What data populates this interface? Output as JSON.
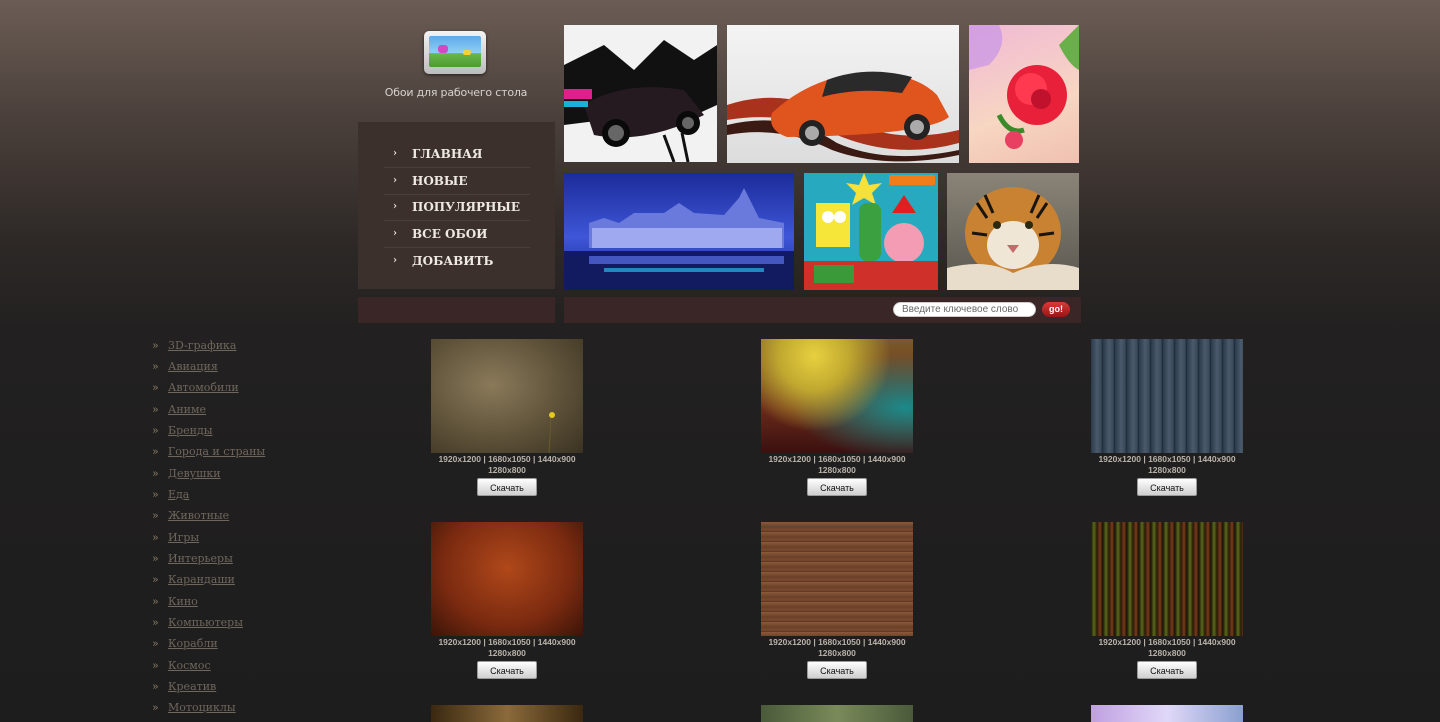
{
  "site": {
    "logo_icon": "desktop-wallpaper-icon",
    "caption": "Обои для рабочего стола"
  },
  "menu": {
    "items": [
      {
        "label": "ГЛАВНАЯ"
      },
      {
        "label": "НОВЫЕ"
      },
      {
        "label": "ПОПУЛЯРНЫЕ"
      },
      {
        "label": "ВСЕ ОБОИ"
      },
      {
        "label": "ДОБАВИТЬ"
      }
    ],
    "arrow_glyph": "›"
  },
  "search": {
    "placeholder": "Введите ключевое слово",
    "button_label": "go!"
  },
  "categories": {
    "bullet": "»",
    "items": [
      "3D-графика",
      "Авиация",
      "Автомобили",
      "Аниме",
      "Бренды",
      "Города и страны",
      "Девушки",
      "Еда",
      "Животные",
      "Игры",
      "Интерьеры",
      "Карандаши",
      "Кино",
      "Компьютеры",
      "Корабли",
      "Космос",
      "Креатив",
      "Мотоциклы"
    ]
  },
  "wallpapers": {
    "resolutions_line1": "1920x1200 | 1680x1050 | 1440x900",
    "resolutions_line2": "1280x800",
    "download_label": "Скачать"
  },
  "colors": {
    "menu_bg": "#3b302c",
    "bar_bg": "#3a2626",
    "go_button": "#c82020",
    "category_link": "#6f665c"
  }
}
